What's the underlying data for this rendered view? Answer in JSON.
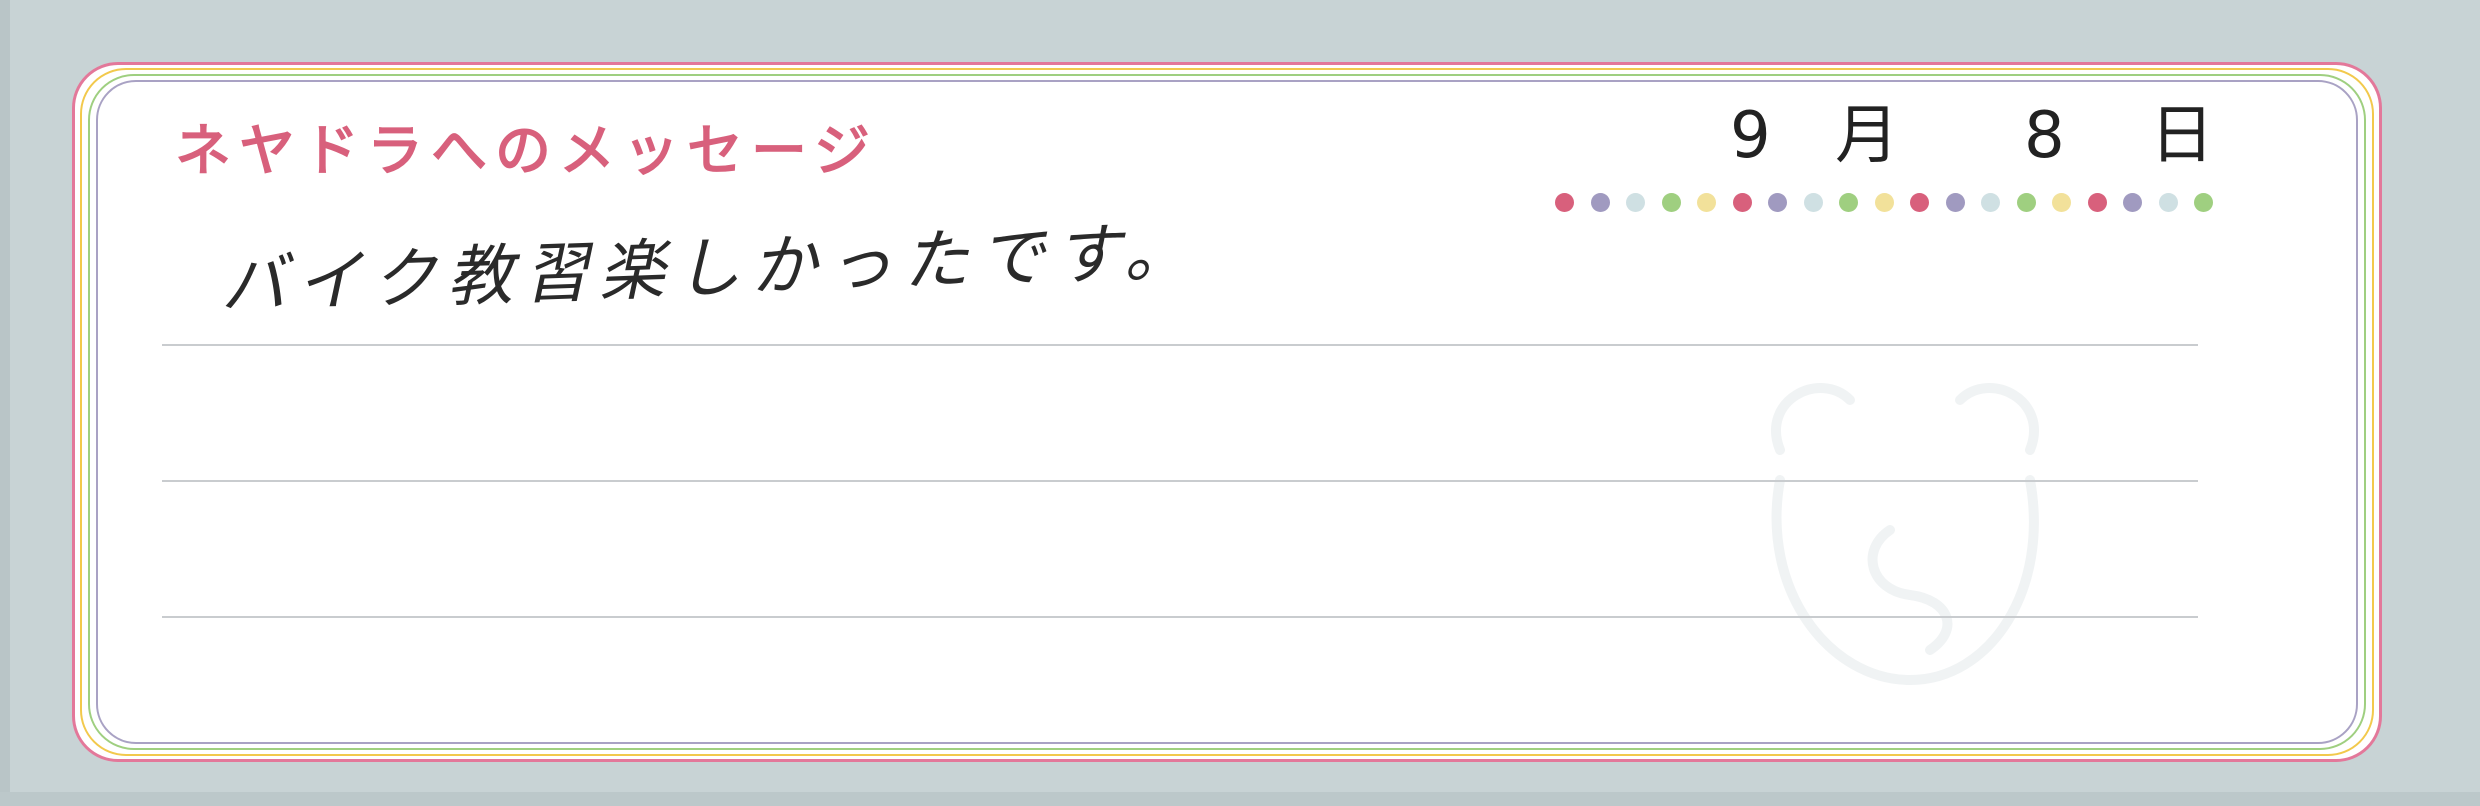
{
  "card": {
    "heading": "ネヤドラへのメッセージ",
    "date": {
      "month": "9",
      "month_unit": "月",
      "day": "8",
      "day_unit": "日"
    },
    "message": "バイク教習楽しかったです。",
    "dot_colors": [
      "#d8607c",
      "#a09ac0",
      "#cfe0e3",
      "#9fcf80",
      "#f2e19a"
    ],
    "colors": {
      "heading": "#d8607c",
      "frame_outer": "#e3789a",
      "frame_yellow": "#f2c94c",
      "frame_green": "#9fcf80",
      "frame_purple": "#a9a2c4"
    }
  }
}
